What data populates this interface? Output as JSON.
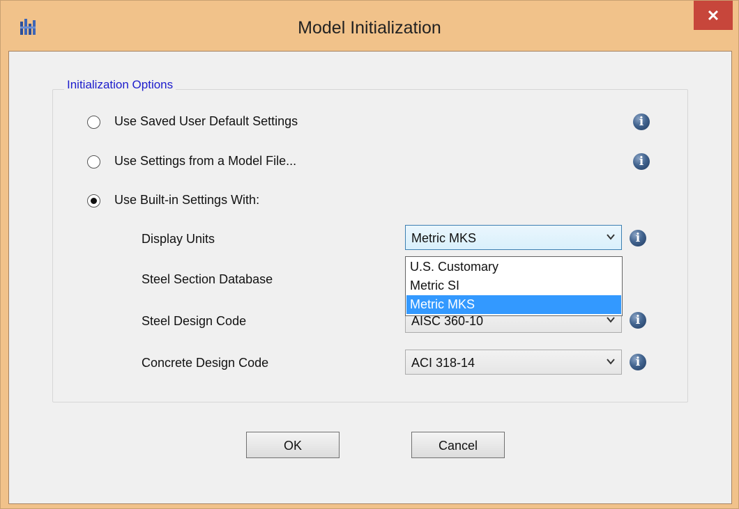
{
  "window": {
    "title": "Model Initialization",
    "close_glyph": "✕",
    "app_icon": "etabs-app-icon"
  },
  "group": {
    "legend": "Initialization Options"
  },
  "options": [
    {
      "label": "Use Saved User Default Settings",
      "selected": false
    },
    {
      "label": "Use Settings from a Model File...",
      "selected": false
    },
    {
      "label": "Use Built-in Settings With:",
      "selected": true
    }
  ],
  "fields": {
    "display_units": {
      "label": "Display Units",
      "value": "Metric MKS"
    },
    "steel_section_db": {
      "label": "Steel Section Database",
      "value": ""
    },
    "steel_design_code": {
      "label": "Steel Design Code",
      "value": "AISC 360-10"
    },
    "concrete_design_code": {
      "label": "Concrete Design Code",
      "value": "ACI 318-14"
    }
  },
  "dropdown": {
    "options": [
      "U.S. Customary",
      "Metric SI",
      "Metric MKS"
    ],
    "selected": "Metric MKS"
  },
  "info_glyph": "i",
  "buttons": {
    "ok": "OK",
    "cancel": "Cancel"
  },
  "colors": {
    "frame": "#f1c28a",
    "close_button": "#c7463b",
    "group_legend": "#1c1ccc",
    "selection": "#3399ff",
    "info_icon": "#42648f"
  }
}
